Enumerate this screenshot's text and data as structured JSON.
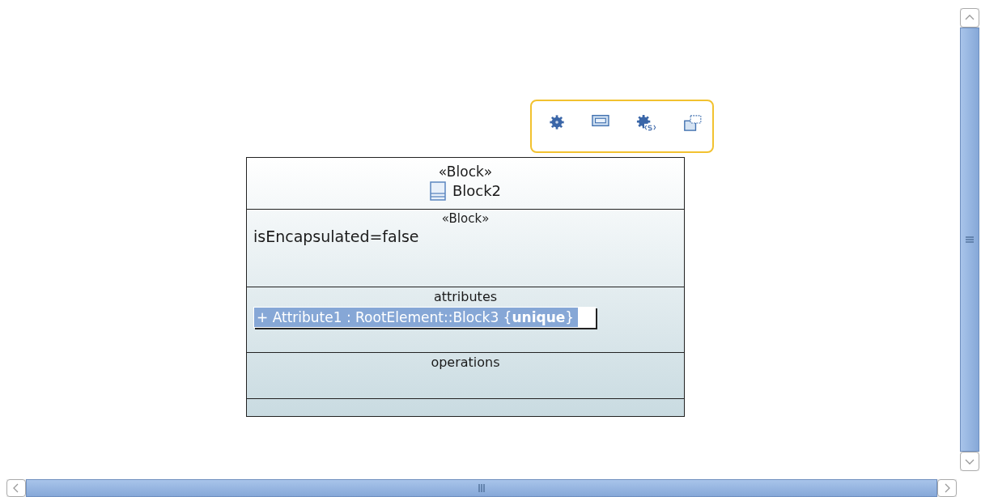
{
  "diagram": {
    "block": {
      "stereotype": "«Block»",
      "name": "Block2",
      "compartments": [
        {
          "kind": "tags",
          "title": "«Block»",
          "items": [
            {
              "text": "isEncapsulated=false"
            }
          ]
        },
        {
          "kind": "list",
          "title": "attributes",
          "items": [
            {
              "text": "+ Attribute1 : RootElement::Block3 {**unique**}",
              "selected": true
            }
          ]
        },
        {
          "kind": "list",
          "title": "operations"
        },
        {
          "kind": "empty"
        }
      ]
    }
  }
}
